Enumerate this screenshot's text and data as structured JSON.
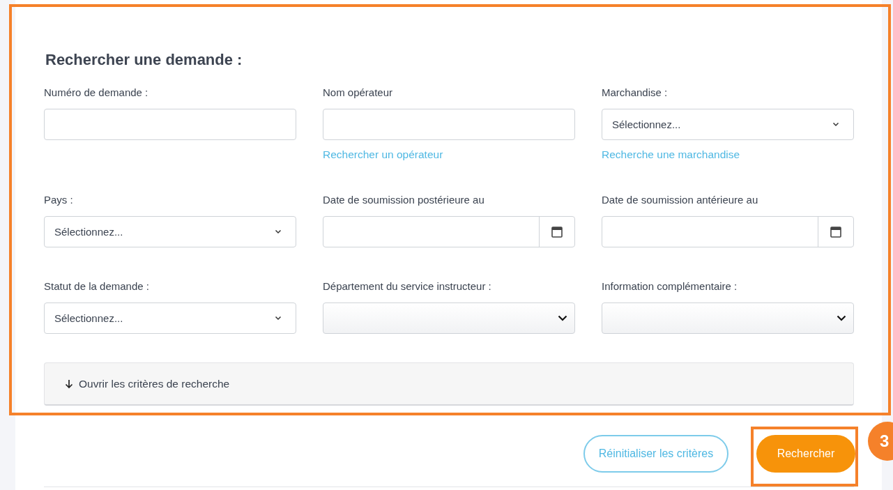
{
  "heading": "Rechercher une demande :",
  "fields": [
    {
      "kind": "text",
      "label": "Numéro de demande :"
    },
    {
      "kind": "text",
      "label": "Nom opérateur",
      "link": "Rechercher un opérateur"
    },
    {
      "kind": "select",
      "label": "Marchandise :",
      "placeholder": "Sélectionnez...",
      "link": "Recherche une marchandise"
    },
    {
      "kind": "select",
      "label": "Pays :",
      "placeholder": "Sélectionnez..."
    },
    {
      "kind": "date",
      "label": "Date de soumission postérieure au"
    },
    {
      "kind": "date",
      "label": "Date de soumission antérieure au"
    },
    {
      "kind": "select",
      "label": "Statut de la demande :",
      "placeholder": "Sélectionnez..."
    },
    {
      "kind": "native_select",
      "label": "Département du service instructeur :"
    },
    {
      "kind": "native_select",
      "label": "Information complémentaire :"
    }
  ],
  "accordion": {
    "label": "Ouvrir les critères de recherche",
    "expanded": false
  },
  "buttons": [
    {
      "kind": "outline",
      "label": "Réinitialiser les critères"
    },
    {
      "kind": "primary",
      "label": "Rechercher"
    }
  ],
  "callout": {
    "number": "3"
  }
}
